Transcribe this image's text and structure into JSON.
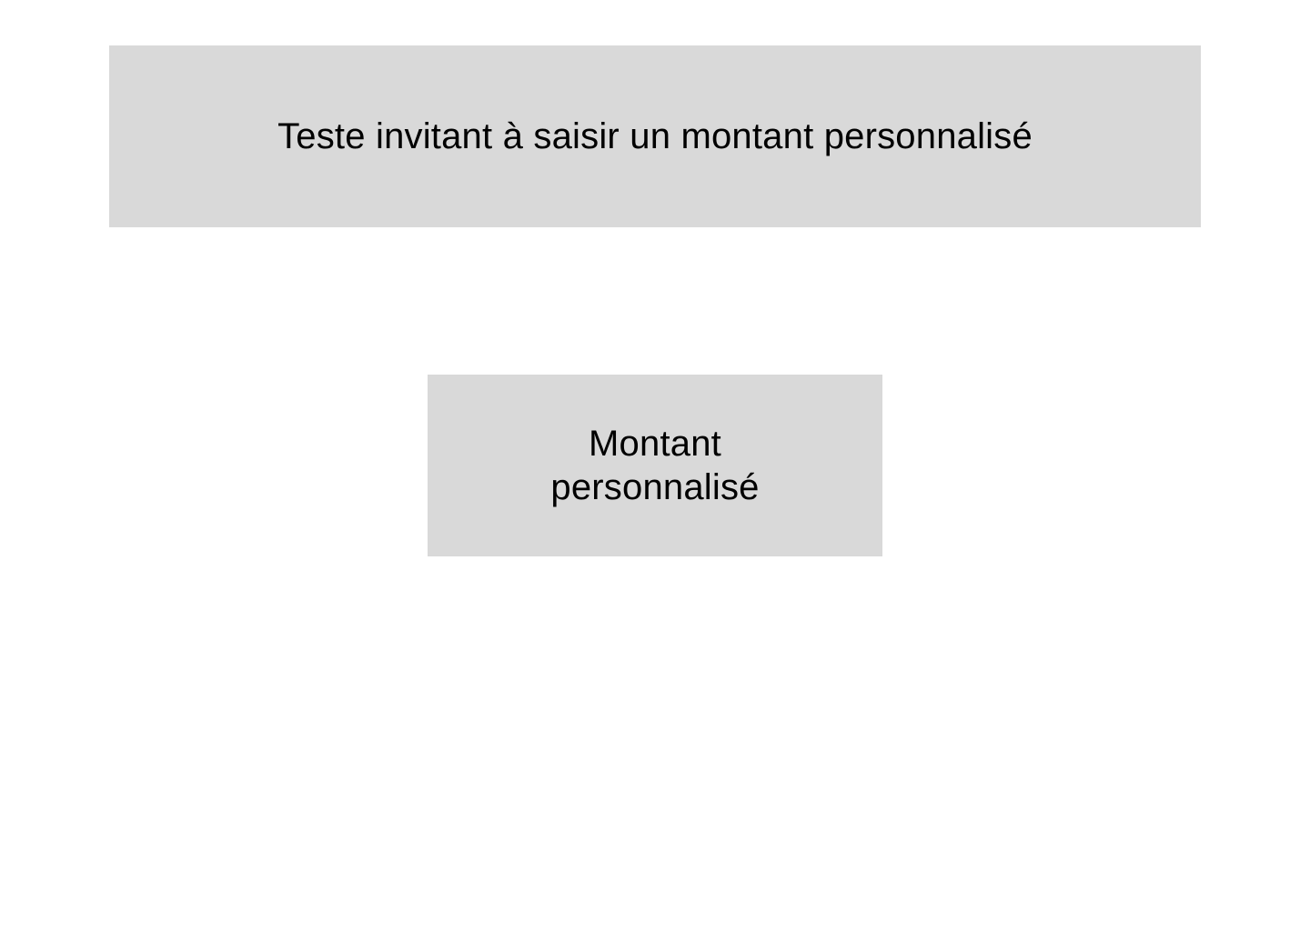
{
  "header": {
    "text": "Teste invitant à saisir un montant personnalisé"
  },
  "custom_amount_button": {
    "label": "Montant personnalisé"
  },
  "colors": {
    "background": "#ffffff",
    "panel": "#d9d9d9",
    "text": "#000000"
  }
}
